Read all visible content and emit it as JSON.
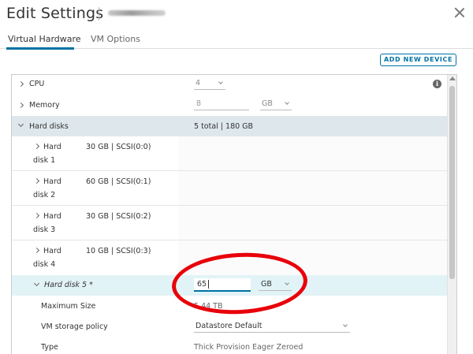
{
  "dialog": {
    "title": "Edit Settings",
    "close_icon": "close-icon"
  },
  "tabs": [
    {
      "label": "Virtual Hardware",
      "active": true
    },
    {
      "label": "VM Options",
      "active": false
    }
  ],
  "toolbar": {
    "add_device_label": "ADD NEW DEVICE"
  },
  "cpu": {
    "label": "CPU",
    "value": "4"
  },
  "memory": {
    "label": "Memory",
    "value": "8",
    "unit": "GB"
  },
  "hard_disks": {
    "label": "Hard disks",
    "summary": "5 total | 180 GB"
  },
  "disks": [
    {
      "label_top": "Hard",
      "label_bottom": "disk 1",
      "info": "30 GB | SCSI(0:0)"
    },
    {
      "label_top": "Hard",
      "label_bottom": "disk 2",
      "info": "60 GB | SCSI(0:1)"
    },
    {
      "label_top": "Hard",
      "label_bottom": "disk 3",
      "info": "30 GB | SCSI(0:2)"
    },
    {
      "label_top": "Hard",
      "label_bottom": "disk 4",
      "info": "10 GB | SCSI(0:3)"
    }
  ],
  "disk5": {
    "label": "Hard disk 5 *",
    "size_value": "65",
    "size_unit": "GB",
    "max_size_label": "Maximum Size",
    "max_size_value": "5.44 TB",
    "policy_label": "VM storage policy",
    "policy_value": "Datastore Default",
    "type_label": "Type",
    "type_value": "Thick Provision Eager Zeroed"
  },
  "colors": {
    "accent": "#0072a3",
    "group_header_bg": "#dee7ec",
    "selected_row_bg": "#e1f3f6",
    "annotation": "#e8000a"
  }
}
